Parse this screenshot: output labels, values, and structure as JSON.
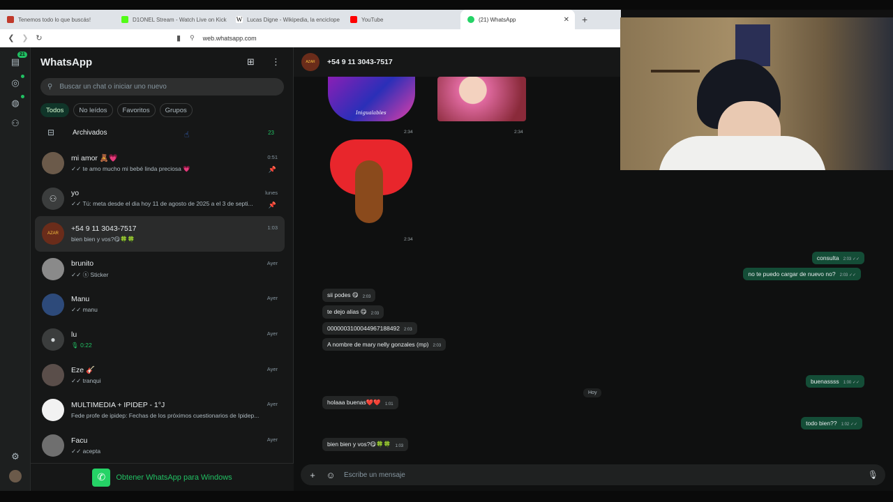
{
  "browser": {
    "tabs": [
      {
        "label": "Tenemos todo lo que buscás!",
        "color": "#c0392b"
      },
      {
        "label": "D1ONEL Stream - Watch Live on Kick",
        "color": "#53fc18"
      },
      {
        "label": "Lucas Digne - Wikipedia, la enciclope",
        "color": "#333333"
      },
      {
        "label": "YouTube",
        "color": "#ff0000"
      },
      {
        "label": "(21) WhatsApp",
        "color": "#25d366"
      }
    ],
    "url": "web.whatsapp.com"
  },
  "rail": {
    "badge": "21"
  },
  "sidebar": {
    "title": "WhatsApp",
    "search_placeholder": "Buscar un chat o iniciar uno nuevo",
    "filters": [
      "Todos",
      "No leídos",
      "Favoritos",
      "Grupos"
    ],
    "archived_label": "Archivados",
    "archived_count": "23",
    "chats": [
      {
        "name": "mi amor 🧸💗",
        "preview": "✓✓ te amo mucho mi bebé linda preciosa 💗",
        "time": "0:51",
        "pinned": true,
        "avatar_color": "#6b5a4a"
      },
      {
        "name": "yo",
        "preview": "✓✓ Tú: meta desde el dia hoy 11 de agosto de 2025 a el 3 de septi...",
        "time": "lunes",
        "pinned": true,
        "avatar_color": "#3b3d3d"
      },
      {
        "name": "+54 9 11 3043-7517",
        "preview": "bien bien y vos?😋🍀🍀",
        "time": "1:03",
        "pinned": false,
        "avatar_color": "#6a2c1a"
      },
      {
        "name": "brunito",
        "preview": "✓✓ ⓢ Sticker",
        "time": "Ayer",
        "pinned": false,
        "avatar_color": "#8a8a8a"
      },
      {
        "name": "Manu",
        "preview": "✓✓ manu",
        "time": "Ayer",
        "pinned": false,
        "avatar_color": "#2d4a7a"
      },
      {
        "name": "lu",
        "preview": "🎙 0:22",
        "time": "Ayer",
        "pinned": false,
        "avatar_color": "#3b3d3d"
      },
      {
        "name": "Eze 🎸",
        "preview": "✓✓ tranqui",
        "time": "Ayer",
        "pinned": false,
        "avatar_color": "#5a4e4a"
      },
      {
        "name": "MULTIMEDIA + IPIDEP - 1°J",
        "preview": "Fede profe de ipidep: Fechas de los próximos cuestionarios de Ipidep...",
        "time": "Ayer",
        "pinned": false,
        "avatar_color": "#f2f2f2"
      },
      {
        "name": "Facu",
        "preview": "✓✓ acepta",
        "time": "Ayer",
        "pinned": false,
        "avatar_color": "#6f6f6f"
      }
    ],
    "get_windows": "Obtener WhatsApp para Windows"
  },
  "conversation": {
    "contact": "+54 9 11 3043-7517",
    "image_stamps": [
      "2:34",
      "2:34",
      "2:34"
    ],
    "image_caption": "Inigualables",
    "messages_out_1": [
      {
        "text": "consulta",
        "time": "2:03 ✓✓"
      },
      {
        "text": "no te puedo cargar de nuevo no?",
        "time": "2:03 ✓✓"
      }
    ],
    "messages_in_1": [
      {
        "text": "sii podes 😋",
        "time": "2:03"
      },
      {
        "text": "te dejo alias 😋",
        "time": "2:03"
      },
      {
        "text": "0000003100044967188492",
        "time": "2:03"
      },
      {
        "text": "A nombre de mary nelly gonzales (mp)",
        "time": "2:03"
      }
    ],
    "day_separator": "Hoy",
    "messages_today": [
      {
        "text": "buenassss",
        "time": "1:00 ✓✓"
      },
      {
        "text": "holaaa buenas❤️❤️",
        "time": "1:01"
      },
      {
        "text": "todo bien??",
        "time": "1:02 ✓✓"
      },
      {
        "text": "bien bien y vos?😋🍀🍀",
        "time": "1:03"
      }
    ],
    "composer_placeholder": "Escribe un mensaje"
  }
}
